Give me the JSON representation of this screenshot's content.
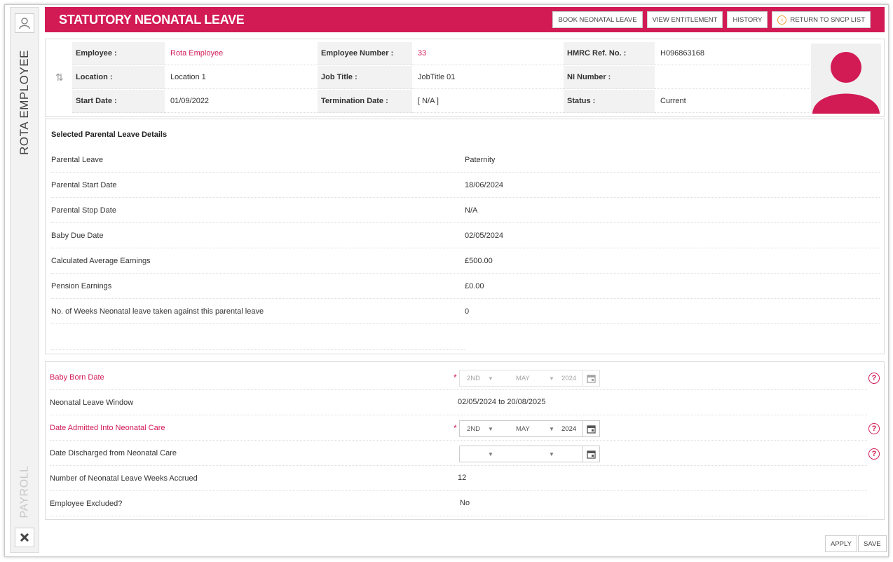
{
  "sidebar": {
    "employee_name": "ROTA EMPLOYEE",
    "module": "PAYROLL"
  },
  "header": {
    "title": "STATUTORY NEONATAL LEAVE",
    "buttons": {
      "book": "BOOK NEONATAL LEAVE",
      "entitlement": "VIEW ENTITLEMENT",
      "history": "HISTORY",
      "return": "RETURN TO SNCP LIST"
    }
  },
  "employee": {
    "employee_label": "Employee :",
    "employee_value": "Rota Employee",
    "number_label": "Employee Number :",
    "number_value": "33",
    "hmrc_label": "HMRC Ref. No. :",
    "hmrc_value": "H096863168",
    "location_label": "Location :",
    "location_value": "Location 1",
    "job_label": "Job Title :",
    "job_value": "JobTitle 01",
    "ni_label": "NI Number :",
    "ni_value": "",
    "start_label": "Start Date :",
    "start_value": "01/09/2022",
    "term_label": "Termination Date :",
    "term_value": "[ N/A ]",
    "status_label": "Status :",
    "status_value": "Current"
  },
  "details": {
    "heading": "Selected Parental Leave Details",
    "rows": [
      {
        "label": "Parental Leave",
        "value": "Paternity"
      },
      {
        "label": "Parental Start Date",
        "value": "18/06/2024"
      },
      {
        "label": "Parental Stop Date",
        "value": "N/A"
      },
      {
        "label": "Baby Due Date",
        "value": "02/05/2024"
      },
      {
        "label": "Calculated Average Earnings",
        "value": "£500.00"
      },
      {
        "label": "Pension Earnings",
        "value": "£0.00"
      },
      {
        "label": "No. of Weeks Neonatal leave taken against this parental leave",
        "value": "0"
      }
    ]
  },
  "form": {
    "baby_born": {
      "label": "Baby Born Date",
      "day": "2ND",
      "month": "MAY",
      "year": "2024"
    },
    "window": {
      "label": "Neonatal Leave Window",
      "value": "02/05/2024 to 20/08/2025"
    },
    "admitted": {
      "label": "Date Admitted Into Neonatal Care",
      "day": "2ND",
      "month": "MAY",
      "year": "2024"
    },
    "discharged": {
      "label": "Date Discharged from Neonatal Care",
      "day": "",
      "month": "",
      "year": ""
    },
    "weeks": {
      "label": "Number of Neonatal Leave Weeks Accrued",
      "value": "12"
    },
    "excluded": {
      "label": "Employee Excluded?",
      "value": "No"
    },
    "required_mark": "*",
    "help_mark": "?"
  },
  "footer": {
    "apply": "APPLY",
    "save": "SAVE"
  },
  "colors": {
    "brand": "#d21a55"
  }
}
